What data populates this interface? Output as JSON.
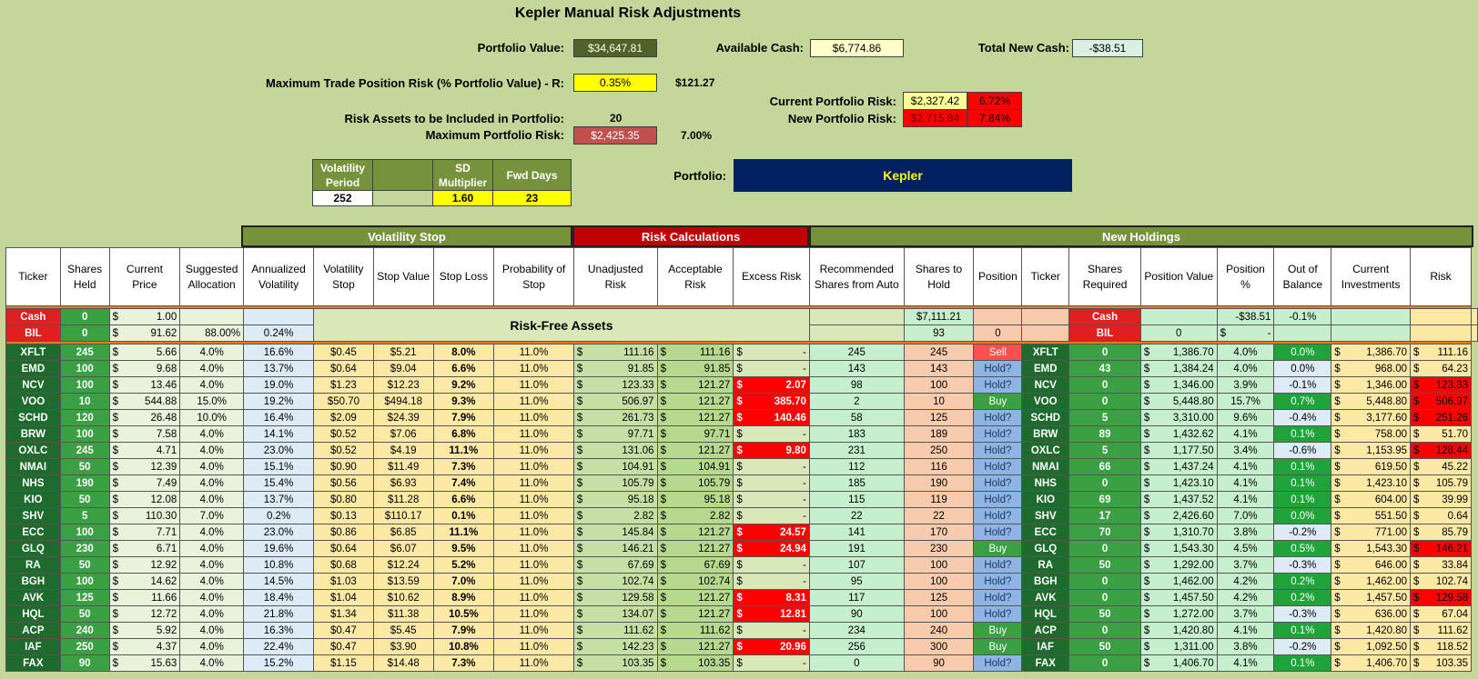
{
  "title": "Kepler Manual Risk Adjustments",
  "top": {
    "portfolio_value_label": "Portfolio Value:",
    "portfolio_value": "$34,647.81",
    "available_cash_label": "Available Cash:",
    "available_cash": "$6,774.86",
    "total_new_cash_label": "Total New Cash:",
    "total_new_cash": "-$38.51",
    "max_trade_label": "Maximum Trade Position Risk (% Portfolio Value) - R:",
    "max_trade_pct": "0.35%",
    "max_trade_amt": "$121.27",
    "current_risk_label": "Current Portfolio Risk:",
    "current_risk": "$2,327.42",
    "current_risk_pct": "6.72%",
    "new_risk_label": "New Portfolio Risk:",
    "new_risk": "$2,715.84",
    "new_risk_pct": "7.84%",
    "risk_assets_label": "Risk Assets to be Included in Portfolio:",
    "risk_assets": "20",
    "max_portfolio_risk_label": "Maximum Portfolio Risk:",
    "max_portfolio_risk": "$2,425.35",
    "max_portfolio_risk_pct": "7.00%",
    "portfolio_label": "Portfolio:",
    "portfolio_name": "Kepler"
  },
  "params": {
    "vol_period_label": "Volatility Period",
    "sd_label": "SD Multiplier",
    "fwd_label": "Fwd Days",
    "vol_period": "252",
    "sd": "1.60",
    "fwd": "23"
  },
  "groups": {
    "vol": "Volatility Stop",
    "risk": "Risk Calculations",
    "new": "New Holdings"
  },
  "headers": [
    "Ticker",
    "Shares Held",
    "Current Price",
    "Suggested Allocation",
    "Annualized Volatility",
    "Volatility Stop",
    "Stop Value",
    "Stop Loss",
    "Probability of Stop",
    "Unadjusted Risk",
    "Acceptable Risk",
    "Excess Risk",
    "Recommended Shares from Auto",
    "Shares to Hold",
    "Position",
    "Ticker",
    "Shares Required",
    "Position Value",
    "Position %",
    "Out of Balance",
    "Current Investments",
    "Risk"
  ],
  "cash_row": {
    "ticker": "Cash",
    "held": "0",
    "price": "1.00",
    "rec": "$7,111.21",
    "ticker2": "Cash",
    "posval": "-$38.51",
    "pospct": "-0.1%"
  },
  "bil_row": {
    "ticker": "BIL",
    "held": "0",
    "price": "91.62",
    "alloc": "88.00%",
    "vol": "0.24%",
    "rec": "93",
    "hold": "0",
    "ticker2": "BIL",
    "req": "0",
    "posval": "-"
  },
  "risk_free_label": "Risk-Free Assets",
  "dollar": "$",
  "dash": "-",
  "rows": [
    {
      "t": "XFLT",
      "h": "245",
      "p": "5.66",
      "a": "4.0%",
      "v": "16.6%",
      "vs": "$0.45",
      "sv": "$5.21",
      "sl": "8.0%",
      "ps": "11.0%",
      "ur": "111.16",
      "ar": "111.16",
      "er": "-",
      "rec": "245",
      "sth": "245",
      "pos": "Sell",
      "req": "0",
      "pv": "1,386.70",
      "pp": "4.0%",
      "ob": "0.0%",
      "ci": "1,386.70",
      "rk": "111.16",
      "exc": false,
      "obh": true,
      "rh": false
    },
    {
      "t": "EMD",
      "h": "100",
      "p": "9.68",
      "a": "4.0%",
      "v": "13.7%",
      "vs": "$0.64",
      "sv": "$9.04",
      "sl": "6.6%",
      "ps": "11.0%",
      "ur": "91.85",
      "ar": "91.85",
      "er": "-",
      "rec": "143",
      "sth": "143",
      "pos": "Hold?",
      "req": "43",
      "pv": "1,384.24",
      "pp": "4.0%",
      "ob": "0.0%",
      "ci": "968.00",
      "rk": "64.23",
      "exc": false,
      "obh": false,
      "rh": false
    },
    {
      "t": "NCV",
      "h": "100",
      "p": "13.46",
      "a": "4.0%",
      "v": "19.0%",
      "vs": "$1.23",
      "sv": "$12.23",
      "sl": "9.2%",
      "ps": "11.0%",
      "ur": "123.33",
      "ar": "121.27",
      "er": "2.07",
      "rec": "98",
      "sth": "100",
      "pos": "Hold?",
      "req": "0",
      "pv": "1,346.00",
      "pp": "3.9%",
      "ob": "-0.1%",
      "ci": "1,346.00",
      "rk": "123.33",
      "exc": true,
      "obh": false,
      "rh": true
    },
    {
      "t": "VOO",
      "h": "10",
      "p": "544.88",
      "a": "15.0%",
      "v": "19.2%",
      "vs": "$50.70",
      "sv": "$494.18",
      "sl": "9.3%",
      "ps": "11.0%",
      "ur": "506.97",
      "ar": "121.27",
      "er": "385.70",
      "rec": "2",
      "sth": "10",
      "pos": "Buy",
      "req": "0",
      "pv": "5,448.80",
      "pp": "15.7%",
      "ob": "0.7%",
      "ci": "5,448.80",
      "rk": "506.97",
      "exc": true,
      "obh": true,
      "rh": true
    },
    {
      "t": "SCHD",
      "h": "120",
      "p": "26.48",
      "a": "10.0%",
      "v": "16.4%",
      "vs": "$2.09",
      "sv": "$24.39",
      "sl": "7.9%",
      "ps": "11.0%",
      "ur": "261.73",
      "ar": "121.27",
      "er": "140.46",
      "rec": "58",
      "sth": "125",
      "pos": "Hold?",
      "req": "5",
      "pv": "3,310.00",
      "pp": "9.6%",
      "ob": "-0.4%",
      "ci": "3,177.60",
      "rk": "251.26",
      "exc": true,
      "obh": false,
      "rh": true
    },
    {
      "t": "BRW",
      "h": "100",
      "p": "7.58",
      "a": "4.0%",
      "v": "14.1%",
      "vs": "$0.52",
      "sv": "$7.06",
      "sl": "6.8%",
      "ps": "11.0%",
      "ur": "97.71",
      "ar": "97.71",
      "er": "-",
      "rec": "183",
      "sth": "189",
      "pos": "Hold?",
      "req": "89",
      "pv": "1,432.62",
      "pp": "4.1%",
      "ob": "0.1%",
      "ci": "758.00",
      "rk": "51.70",
      "exc": false,
      "obh": true,
      "rh": false
    },
    {
      "t": "OXLC",
      "h": "245",
      "p": "4.71",
      "a": "4.0%",
      "v": "23.0%",
      "vs": "$0.52",
      "sv": "$4.19",
      "sl": "11.1%",
      "ps": "11.0%",
      "ur": "131.06",
      "ar": "121.27",
      "er": "9.80",
      "rec": "231",
      "sth": "250",
      "pos": "Hold?",
      "req": "5",
      "pv": "1,177.50",
      "pp": "3.4%",
      "ob": "-0.6%",
      "ci": "1,153.95",
      "rk": "128.44",
      "exc": true,
      "obh": false,
      "rh": true
    },
    {
      "t": "NMAI",
      "h": "50",
      "p": "12.39",
      "a": "4.0%",
      "v": "15.1%",
      "vs": "$0.90",
      "sv": "$11.49",
      "sl": "7.3%",
      "ps": "11.0%",
      "ur": "104.91",
      "ar": "104.91",
      "er": "-",
      "rec": "112",
      "sth": "116",
      "pos": "Hold?",
      "req": "66",
      "pv": "1,437.24",
      "pp": "4.1%",
      "ob": "0.1%",
      "ci": "619.50",
      "rk": "45.22",
      "exc": false,
      "obh": true,
      "rh": false
    },
    {
      "t": "NHS",
      "h": "190",
      "p": "7.49",
      "a": "4.0%",
      "v": "15.4%",
      "vs": "$0.56",
      "sv": "$6.93",
      "sl": "7.4%",
      "ps": "11.0%",
      "ur": "105.79",
      "ar": "105.79",
      "er": "-",
      "rec": "185",
      "sth": "190",
      "pos": "Hold?",
      "req": "0",
      "pv": "1,423.10",
      "pp": "4.1%",
      "ob": "0.1%",
      "ci": "1,423.10",
      "rk": "105.79",
      "exc": false,
      "obh": true,
      "rh": false
    },
    {
      "t": "KIO",
      "h": "50",
      "p": "12.08",
      "a": "4.0%",
      "v": "13.7%",
      "vs": "$0.80",
      "sv": "$11.28",
      "sl": "6.6%",
      "ps": "11.0%",
      "ur": "95.18",
      "ar": "95.18",
      "er": "-",
      "rec": "115",
      "sth": "119",
      "pos": "Hold?",
      "req": "69",
      "pv": "1,437.52",
      "pp": "4.1%",
      "ob": "0.1%",
      "ci": "604.00",
      "rk": "39.99",
      "exc": false,
      "obh": true,
      "rh": false
    },
    {
      "t": "SHV",
      "h": "5",
      "p": "110.30",
      "a": "7.0%",
      "v": "0.2%",
      "vs": "$0.13",
      "sv": "$110.17",
      "sl": "0.1%",
      "ps": "11.0%",
      "ur": "2.82",
      "ar": "2.82",
      "er": "-",
      "rec": "22",
      "sth": "22",
      "pos": "Hold?",
      "req": "17",
      "pv": "2,426.60",
      "pp": "7.0%",
      "ob": "0.0%",
      "ci": "551.50",
      "rk": "0.64",
      "exc": false,
      "obh": true,
      "rh": false
    },
    {
      "t": "ECC",
      "h": "100",
      "p": "7.71",
      "a": "4.0%",
      "v": "23.0%",
      "vs": "$0.86",
      "sv": "$6.85",
      "sl": "11.1%",
      "ps": "11.0%",
      "ur": "145.84",
      "ar": "121.27",
      "er": "24.57",
      "rec": "141",
      "sth": "170",
      "pos": "Hold?",
      "req": "70",
      "pv": "1,310.70",
      "pp": "3.8%",
      "ob": "-0.2%",
      "ci": "771.00",
      "rk": "85.79",
      "exc": true,
      "obh": false,
      "rh": false
    },
    {
      "t": "GLQ",
      "h": "230",
      "p": "6.71",
      "a": "4.0%",
      "v": "19.6%",
      "vs": "$0.64",
      "sv": "$6.07",
      "sl": "9.5%",
      "ps": "11.0%",
      "ur": "146.21",
      "ar": "121.27",
      "er": "24.94",
      "rec": "191",
      "sth": "230",
      "pos": "Buy",
      "req": "0",
      "pv": "1,543.30",
      "pp": "4.5%",
      "ob": "0.5%",
      "ci": "1,543.30",
      "rk": "146.21",
      "exc": true,
      "obh": true,
      "rh": true
    },
    {
      "t": "RA",
      "h": "50",
      "p": "12.92",
      "a": "4.0%",
      "v": "10.8%",
      "vs": "$0.68",
      "sv": "$12.24",
      "sl": "5.2%",
      "ps": "11.0%",
      "ur": "67.69",
      "ar": "67.69",
      "er": "-",
      "rec": "107",
      "sth": "100",
      "pos": "Hold?",
      "req": "50",
      "pv": "1,292.00",
      "pp": "3.7%",
      "ob": "-0.3%",
      "ci": "646.00",
      "rk": "33.84",
      "exc": false,
      "obh": false,
      "rh": false
    },
    {
      "t": "BGH",
      "h": "100",
      "p": "14.62",
      "a": "4.0%",
      "v": "14.5%",
      "vs": "$1.03",
      "sv": "$13.59",
      "sl": "7.0%",
      "ps": "11.0%",
      "ur": "102.74",
      "ar": "102.74",
      "er": "-",
      "rec": "95",
      "sth": "100",
      "pos": "Hold?",
      "req": "0",
      "pv": "1,462.00",
      "pp": "4.2%",
      "ob": "0.2%",
      "ci": "1,462.00",
      "rk": "102.74",
      "exc": false,
      "obh": true,
      "rh": false
    },
    {
      "t": "AVK",
      "h": "125",
      "p": "11.66",
      "a": "4.0%",
      "v": "18.4%",
      "vs": "$1.04",
      "sv": "$10.62",
      "sl": "8.9%",
      "ps": "11.0%",
      "ur": "129.58",
      "ar": "121.27",
      "er": "8.31",
      "rec": "117",
      "sth": "125",
      "pos": "Hold?",
      "req": "0",
      "pv": "1,457.50",
      "pp": "4.2%",
      "ob": "0.2%",
      "ci": "1,457.50",
      "rk": "129.58",
      "exc": true,
      "obh": true,
      "rh": true
    },
    {
      "t": "HQL",
      "h": "50",
      "p": "12.72",
      "a": "4.0%",
      "v": "21.8%",
      "vs": "$1.34",
      "sv": "$11.38",
      "sl": "10.5%",
      "ps": "11.0%",
      "ur": "134.07",
      "ar": "121.27",
      "er": "12.81",
      "rec": "90",
      "sth": "100",
      "pos": "Hold?",
      "req": "50",
      "pv": "1,272.00",
      "pp": "3.7%",
      "ob": "-0.3%",
      "ci": "636.00",
      "rk": "67.04",
      "exc": true,
      "obh": false,
      "rh": false
    },
    {
      "t": "ACP",
      "h": "240",
      "p": "5.92",
      "a": "4.0%",
      "v": "16.3%",
      "vs": "$0.47",
      "sv": "$5.45",
      "sl": "7.9%",
      "ps": "11.0%",
      "ur": "111.62",
      "ar": "111.62",
      "er": "-",
      "rec": "234",
      "sth": "240",
      "pos": "Buy",
      "req": "0",
      "pv": "1,420.80",
      "pp": "4.1%",
      "ob": "0.1%",
      "ci": "1,420.80",
      "rk": "111.62",
      "exc": false,
      "obh": true,
      "rh": false
    },
    {
      "t": "IAF",
      "h": "250",
      "p": "4.37",
      "a": "4.0%",
      "v": "22.4%",
      "vs": "$0.47",
      "sv": "$3.90",
      "sl": "10.8%",
      "ps": "11.0%",
      "ur": "142.23",
      "ar": "121.27",
      "er": "20.96",
      "rec": "256",
      "sth": "300",
      "pos": "Buy",
      "req": "50",
      "pv": "1,311.00",
      "pp": "3.8%",
      "ob": "-0.2%",
      "ci": "1,092.50",
      "rk": "118.52",
      "exc": true,
      "obh": false,
      "rh": false
    },
    {
      "t": "FAX",
      "h": "90",
      "p": "15.63",
      "a": "4.0%",
      "v": "15.2%",
      "vs": "$1.15",
      "sv": "$14.48",
      "sl": "7.3%",
      "ps": "11.0%",
      "ur": "103.35",
      "ar": "103.35",
      "er": "-",
      "rec": "0",
      "sth": "90",
      "pos": "Hold?",
      "req": "0",
      "pv": "1,406.70",
      "pp": "4.1%",
      "ob": "0.1%",
      "ci": "1,406.70",
      "rk": "103.35",
      "exc": false,
      "obh": true,
      "rh": false
    }
  ]
}
